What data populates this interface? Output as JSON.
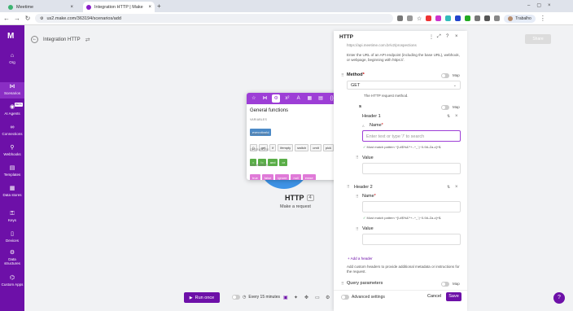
{
  "browser": {
    "tabs": [
      {
        "label": "Meetime",
        "icon": "meetime-favicon"
      },
      {
        "label": "Integration HTTP | Make",
        "icon": "make-favicon"
      }
    ],
    "url": "us2.make.com/363194/scenarios/add",
    "profile": "Trabalho"
  },
  "sidebar": {
    "items": [
      {
        "label": "Org",
        "icon": "home-icon"
      },
      {
        "label": "Scenarios",
        "icon": "share-icon"
      },
      {
        "label": "AI Agents",
        "icon": "ai-agent-icon",
        "badge": "BETA"
      },
      {
        "label": "Connections",
        "icon": "link-icon"
      },
      {
        "label": "Webhooks",
        "icon": "webhook-icon"
      },
      {
        "label": "Templates",
        "icon": "template-icon"
      },
      {
        "label": "Data stores",
        "icon": "database-icon"
      },
      {
        "label": "Keys",
        "icon": "key-icon"
      },
      {
        "label": "Devices",
        "icon": "device-icon"
      },
      {
        "label": "Data structures",
        "icon": "structure-icon"
      },
      {
        "label": "Custom Apps",
        "icon": "custom-apps-icon"
      }
    ]
  },
  "canvas": {
    "title": "Integration HTTP",
    "share_label": "Share",
    "module": {
      "name": "HTTP",
      "number": "4",
      "subtitle": "Make a request"
    },
    "run_once": "Run once",
    "schedule": "Every 15 minutes"
  },
  "functions_popup": {
    "heading": "General functions",
    "variables_label": "VARIABLES",
    "variables": [
      "executionId"
    ],
    "functions_label": "FUNCTIONS",
    "functions": [
      "()",
      "get",
      "if",
      "ifempty",
      "switch",
      "omit",
      "pick"
    ],
    "operators_label": "OPERATORS",
    "operators": [
      "=",
      "!=",
      "and",
      "or"
    ],
    "keywords_label": "KEYWORDS",
    "keywords": [
      "true",
      "false",
      "ignore",
      "null",
      "erase"
    ]
  },
  "panel": {
    "title": "HTTP",
    "url_hint_partial": "https://api.meetime.com.br/v2/prospections",
    "url_help": "Enter the URL of an API endpoint (including the base URL), webhook, or webpage, beginning with https://.",
    "method_label": "Method",
    "method_required": "*",
    "map_label": "Map",
    "method_value": "GET",
    "method_help": "The HTTP request method.",
    "headers_letter": "s",
    "header1": "Header 1",
    "name_label": "Name",
    "name_placeholder": "Enter text or type '/' to search",
    "pattern1": "Must match pattern ^[!-#$%&'*+-.^_`|~0-9A-Za-z]+$.",
    "value_label": "Value",
    "header2": "Header 2",
    "pattern2": "Must match pattern ^[!-#$%&'*+-.^_`|~0-9A-Za-z]+$.",
    "add_header": "Add a header",
    "add_header_help": "Add custom headers to provide additional metadata or instructions for the request.",
    "query_label": "Query parameters",
    "advanced": "Advanced settings",
    "cancel": "Cancel",
    "save": "Save"
  }
}
